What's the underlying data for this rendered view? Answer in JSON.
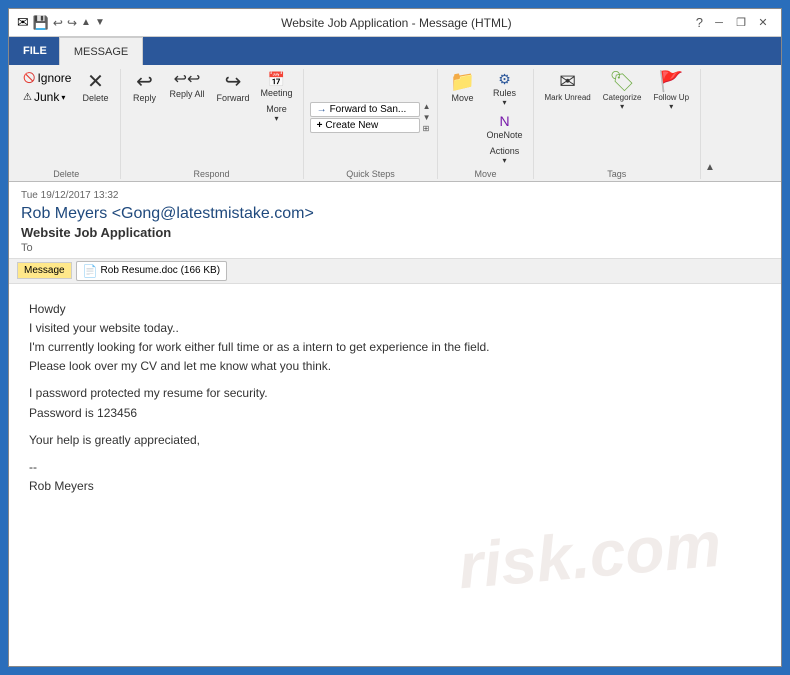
{
  "window": {
    "title": "Website Job Application - Message (HTML)",
    "tabs": {
      "file": "FILE",
      "message": "MESSAGE"
    }
  },
  "ribbon": {
    "groups": {
      "delete": {
        "label": "Delete",
        "ignore": "Ignore",
        "junk": "Junk",
        "delete": "Delete"
      },
      "respond": {
        "label": "Respond",
        "reply": "Reply",
        "reply_all": "Reply All",
        "forward": "Forward",
        "meeting": "Meeting",
        "more": "More"
      },
      "quicksteps": {
        "label": "Quick Steps",
        "forward_to_san": "Forward to San...",
        "create_new": "Create New"
      },
      "move": {
        "label": "Move",
        "move": "Move",
        "rules": "Rules",
        "onenote": "OneNote",
        "actions": "Actions"
      },
      "tags": {
        "label": "Tags",
        "mark_unread": "Mark Unread",
        "categorize": "Categorize",
        "follow_up": "Follow Up"
      }
    }
  },
  "email": {
    "date": "Tue 19/12/2017 13:32",
    "from": "Rob Meyers <Gong@latestmistake.com>",
    "subject": "Website Job Application",
    "to_label": "To",
    "message_tab": "Message",
    "attachment": "Rob Resume.doc (166 KB)",
    "body": {
      "line1": "Howdy",
      "line2": "I visited your website today..",
      "line3": "I'm currently looking for work either full time or as a intern to get experience in the field.",
      "line4": "Please look over my CV and let me know what you think.",
      "line5": "",
      "line6": "I password protected my resume for security.",
      "line7": "Password is 123456",
      "line8": "",
      "line9": "Your help is greatly appreciated,",
      "line10": "",
      "line11": "--",
      "line12": "Rob Meyers"
    },
    "watermark": "risk.com"
  },
  "icons": {
    "ignore": "🚫",
    "junk": "⚠",
    "delete": "✕",
    "reply": "↩",
    "reply_all": "↩↩",
    "forward": "↪",
    "meeting": "📅",
    "more": "⋯",
    "forward_icon": "→",
    "create_new": "+",
    "move": "📁",
    "rules": "⚙",
    "onenote": "N",
    "actions": "▾",
    "mark_unread": "✉",
    "categorize": "🏷",
    "flag": "🚩",
    "follow_up": "↑",
    "attachment_doc": "📄",
    "help": "?",
    "minimize": "─",
    "restore": "❐",
    "close": "✕",
    "undo": "↩",
    "redo": "↪",
    "up": "▲",
    "down": "▼",
    "collapse": "▲"
  }
}
